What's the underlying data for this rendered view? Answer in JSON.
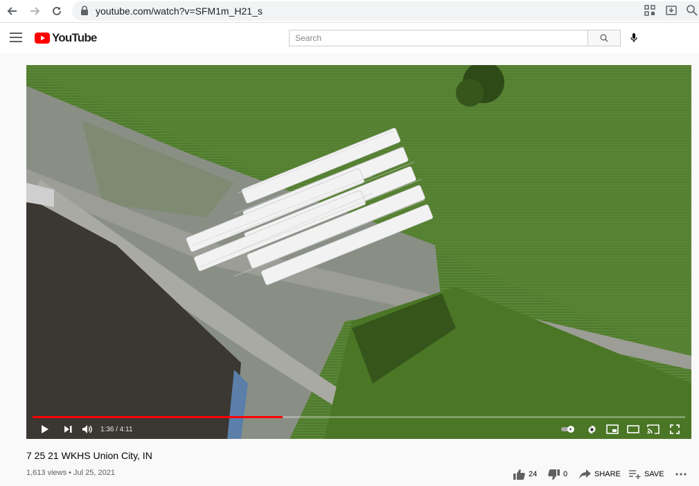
{
  "browser": {
    "url": "youtube.com/watch?v=SFM1m_H21_s"
  },
  "header": {
    "logo_text": "YouTube",
    "search_placeholder": "Search"
  },
  "player": {
    "current_time": "1:36",
    "duration": "4:11",
    "time_display": "1:36 / 4:11",
    "progress_fraction": 0.383,
    "buffered_fraction": 1.0
  },
  "video": {
    "title": "7 25 21 WKHS Union City, IN",
    "meta": "1,613 views • Jul 25, 2021",
    "likes": "24",
    "dislikes": "0",
    "share_label": "SHARE",
    "save_label": "SAVE"
  },
  "colors": {
    "brand_red": "#ff0000",
    "progress": "#ff0000"
  }
}
